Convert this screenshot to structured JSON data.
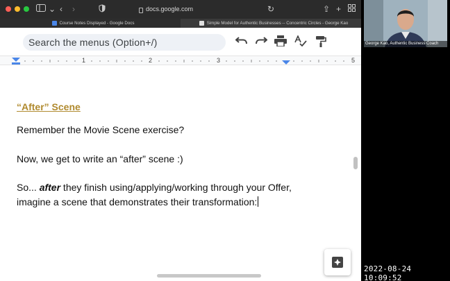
{
  "browser": {
    "url": "docs.google.com",
    "tabs": [
      {
        "label": "Course Notes Displayed - Google Docs",
        "favicon_color": "#4a86e8"
      },
      {
        "label": "Simple Model for Authentic Businesses -- Concentric Circles - George Kao",
        "favicon_color": "#e0e0e0"
      }
    ]
  },
  "toolbar": {
    "search_placeholder": "Search the menus (Option+/)",
    "icons": [
      "undo-icon",
      "redo-icon",
      "print-icon",
      "spellcheck-icon",
      "paint-format-icon"
    ]
  },
  "ruler": {
    "labels": [
      "1",
      "2",
      "3",
      "5"
    ]
  },
  "document": {
    "heading": "“After” Scene",
    "para1": "Remember the Movie Scene exercise?",
    "para2": "Now, we get to write an “after” scene :)",
    "para3_before": "So... ",
    "para3_em": "after",
    "para3_after": " they finish using/applying/working through your Offer, imagine a scene that demonstrates their transformation:"
  },
  "video": {
    "name_label": "George Kao, Authentic Business Coach"
  },
  "overlay": {
    "timestamp": "2022-08-24 10:09:52"
  },
  "colors": {
    "heading": "#b08a2e",
    "ruler_marker": "#4a86e8",
    "chrome_bg": "#2b2b2b"
  }
}
